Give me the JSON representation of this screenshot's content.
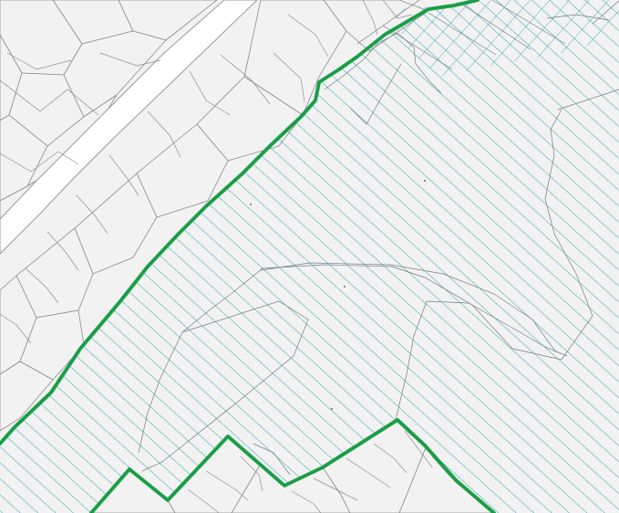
{
  "map": {
    "hatch_color": "#2aa3ad",
    "boundary_color": "#1ea24a",
    "background_color": "#f2f2f2",
    "road_color": "#ffffff",
    "parcel_stroke_color": "#8c8c8c"
  }
}
